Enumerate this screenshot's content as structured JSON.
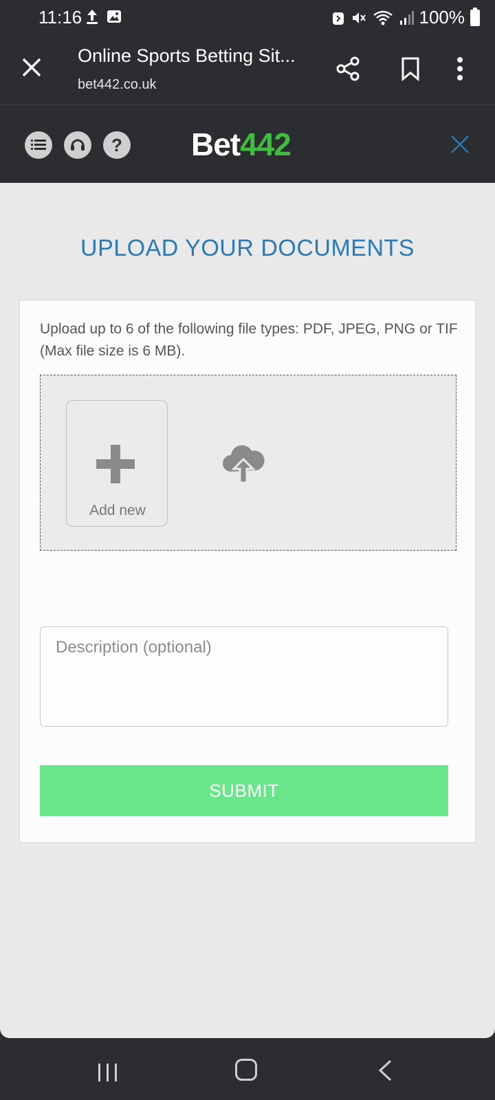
{
  "status_bar": {
    "time": "11:16",
    "battery": "100%",
    "icons": [
      "upload-icon",
      "image-icon",
      "alarm-icon",
      "mute-icon",
      "wifi-icon",
      "signal-icon",
      "battery-icon"
    ]
  },
  "browser": {
    "title": "Online Sports Betting Sit...",
    "url": "bet442.co.uk"
  },
  "site_header": {
    "logo_part1": "Bet",
    "logo_part2": "442",
    "help_label": "?"
  },
  "upload": {
    "title": "UPLOAD YOUR DOCUMENTS",
    "instructions": "Upload up to 6 of the following file types: PDF, JPEG, PNG or TIF (Max file size is 6 MB).",
    "add_new_label": "Add new",
    "description_placeholder": "Description (optional)",
    "submit_label": "SUBMIT"
  },
  "colors": {
    "title_blue": "#2a7ab8",
    "logo_green": "#3ebd3e",
    "submit_green": "#6ae68a",
    "chrome_dark": "#2b2d31"
  }
}
